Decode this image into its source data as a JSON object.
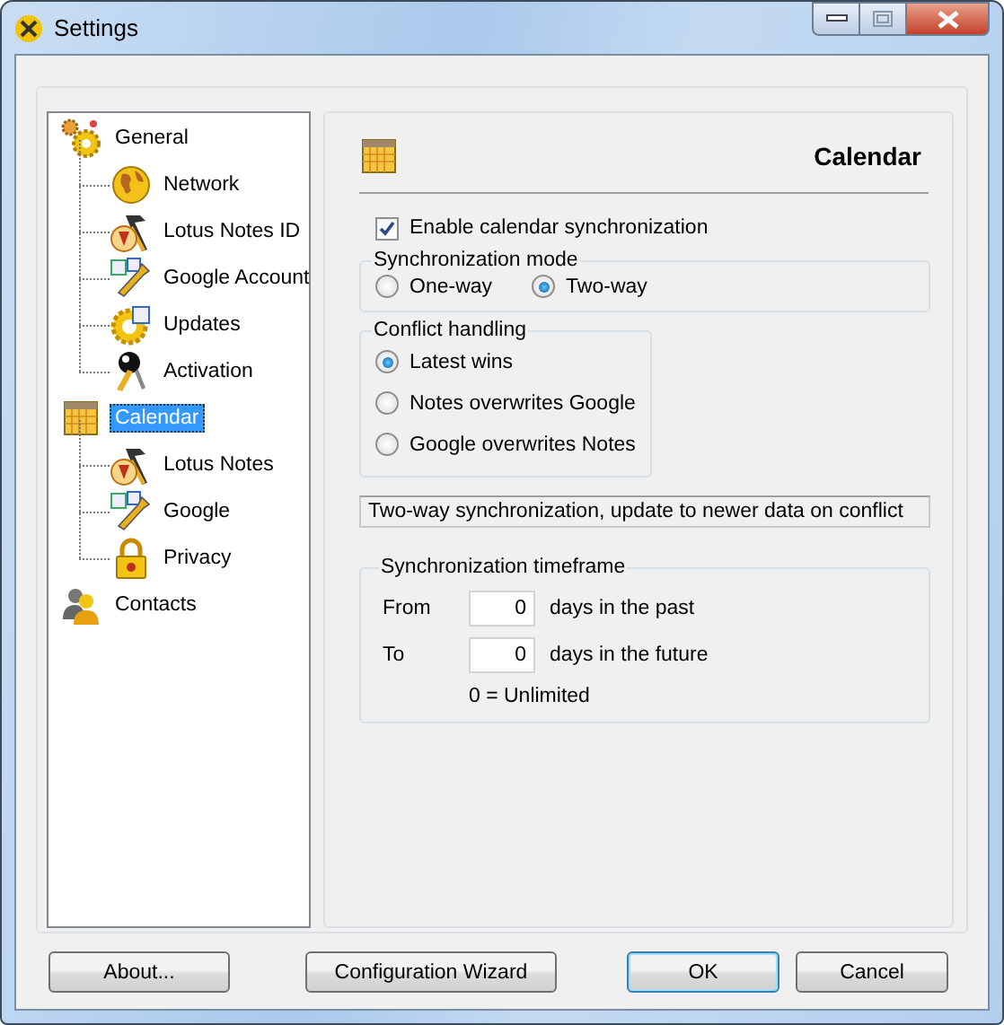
{
  "window": {
    "title": "Settings"
  },
  "sidebar": {
    "items": [
      {
        "label": "General",
        "selected": false,
        "children": [
          {
            "label": "Network",
            "selected": false
          },
          {
            "label": "Lotus Notes ID",
            "selected": false
          },
          {
            "label": "Google Account",
            "selected": false
          },
          {
            "label": "Updates",
            "selected": false
          },
          {
            "label": "Activation",
            "selected": false
          }
        ]
      },
      {
        "label": "Calendar",
        "selected": true,
        "children": [
          {
            "label": "Lotus Notes",
            "selected": false
          },
          {
            "label": "Google",
            "selected": false
          },
          {
            "label": "Privacy",
            "selected": false
          }
        ]
      },
      {
        "label": "Contacts",
        "selected": false
      }
    ]
  },
  "page": {
    "title": "Calendar",
    "enable_sync": {
      "label": "Enable calendar synchronization",
      "checked": true
    },
    "sync_mode": {
      "title": "Synchronization mode",
      "options": [
        {
          "label": "One-way",
          "selected": false
        },
        {
          "label": "Two-way",
          "selected": true
        }
      ]
    },
    "conflict": {
      "title": "Conflict handling",
      "options": [
        {
          "label": "Latest wins",
          "selected": true
        },
        {
          "label": "Notes overwrites Google",
          "selected": false
        },
        {
          "label": "Google overwrites Notes",
          "selected": false
        }
      ]
    },
    "description": "Two-way synchronization, update to newer data on conflict",
    "timeframe": {
      "title": "Synchronization timeframe",
      "rows": [
        {
          "label": "From",
          "value": "0",
          "unit": "days in the past"
        },
        {
          "label": "To",
          "value": "0",
          "unit": "days in the future"
        }
      ],
      "note": "0 = Unlimited"
    }
  },
  "buttons": [
    {
      "label": "About...",
      "default": false
    },
    {
      "label": "Configuration Wizard",
      "default": false
    },
    {
      "label": "OK",
      "default": true
    },
    {
      "label": "Cancel",
      "default": false
    }
  ]
}
